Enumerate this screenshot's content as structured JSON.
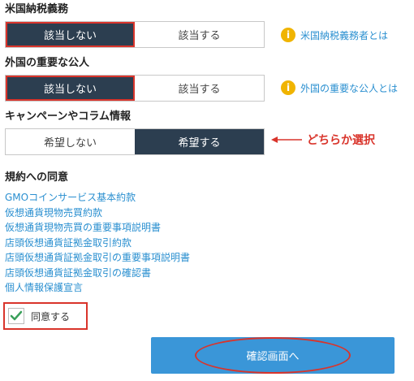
{
  "us_tax": {
    "title": "米国納税義務",
    "options": [
      "該当しない",
      "該当する"
    ],
    "selected": "該当しない",
    "info_text": "米国納税義務者とは"
  },
  "foreign_pep": {
    "title": "外国の重要な公人",
    "options": [
      "該当しない",
      "該当する"
    ],
    "selected": "該当しない",
    "info_text": "外国の重要な公人とは"
  },
  "campaign": {
    "title": "キャンペーンやコラム情報",
    "options": [
      "希望しない",
      "希望する"
    ],
    "selected": "希望する",
    "annotation": "どちらか選択"
  },
  "terms": {
    "title": "規約への同意",
    "links": [
      "GMOコインサービス基本約款",
      "仮想通貨現物売買約款",
      "仮想通貨現物売買の重要事項説明書",
      "店頭仮想通貨証拠金取引約款",
      "店頭仮想通貨証拠金取引の重要事項説明書",
      "店頭仮想通貨証拠金取引の確認書",
      "個人情報保護宣言"
    ],
    "agree_label": "同意する",
    "agree_checked": true
  },
  "confirm_button": "確認画面へ",
  "info_icon_glyph": "i",
  "colors": {
    "selected_bg": "#2c3e50",
    "link": "#2a8fd0",
    "highlight": "#d9342b",
    "button": "#3a96d8",
    "info_icon": "#f0b400",
    "check": "#3aa05a"
  }
}
